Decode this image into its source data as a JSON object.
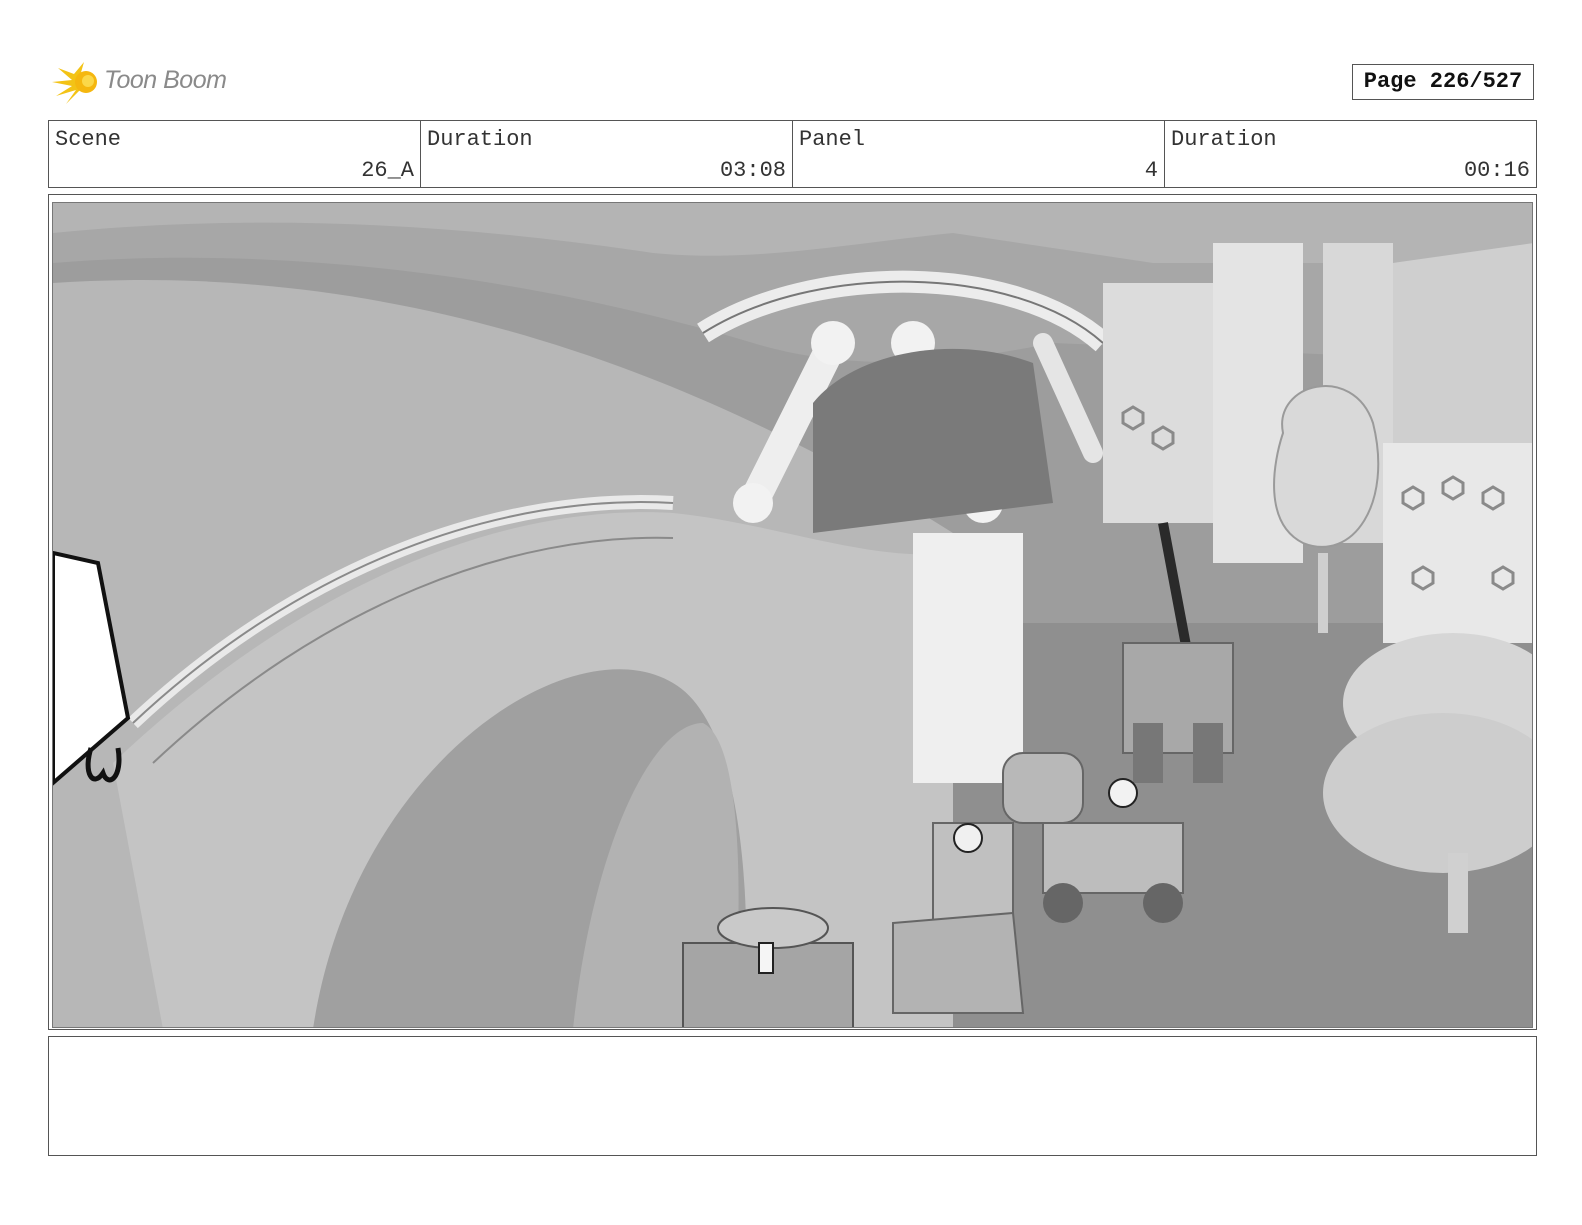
{
  "header": {
    "logo_text": "Toon Boom",
    "page_label": "Page 226/527"
  },
  "info": {
    "scene_label": "Scene",
    "scene_value": "26_A",
    "scene_duration_label": "Duration",
    "scene_duration_value": "03:08",
    "panel_label": "Panel",
    "panel_value": "4",
    "panel_duration_label": "Duration",
    "panel_duration_value": "00:16"
  },
  "notes": {
    "text": ""
  }
}
